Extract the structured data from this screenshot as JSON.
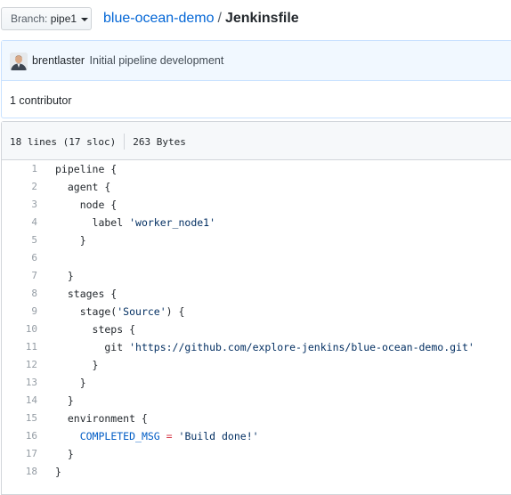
{
  "header": {
    "branch_prefix": "Branch:",
    "branch_name": "pipe1",
    "repo_name": "blue-ocean-demo",
    "separator": "/",
    "file_name": "Jenkinsfile"
  },
  "commit": {
    "author": "brentlaster",
    "message": "Initial pipeline development"
  },
  "contributors": {
    "label": "1 contributor"
  },
  "file": {
    "lines_info": "18 lines (17 sloc)",
    "size": "263 Bytes",
    "code_lines": [
      "pipeline {",
      "  agent {",
      "    node {",
      "      label 'worker_node1'",
      "    }",
      "",
      "  }",
      "  stages {",
      "    stage('Source') {",
      "      steps {",
      "        git 'https://github.com/explore-jenkins/blue-ocean-demo.git'",
      "      }",
      "    }",
      "  }",
      "  environment {",
      "    COMPLETED_MSG = 'Build done!'",
      "  }",
      "}"
    ]
  },
  "colors": {
    "link": "#0366d6",
    "string": "#032f62",
    "constant": "#005cc5",
    "operator": "#d73a49",
    "line_number": "#959da5"
  }
}
